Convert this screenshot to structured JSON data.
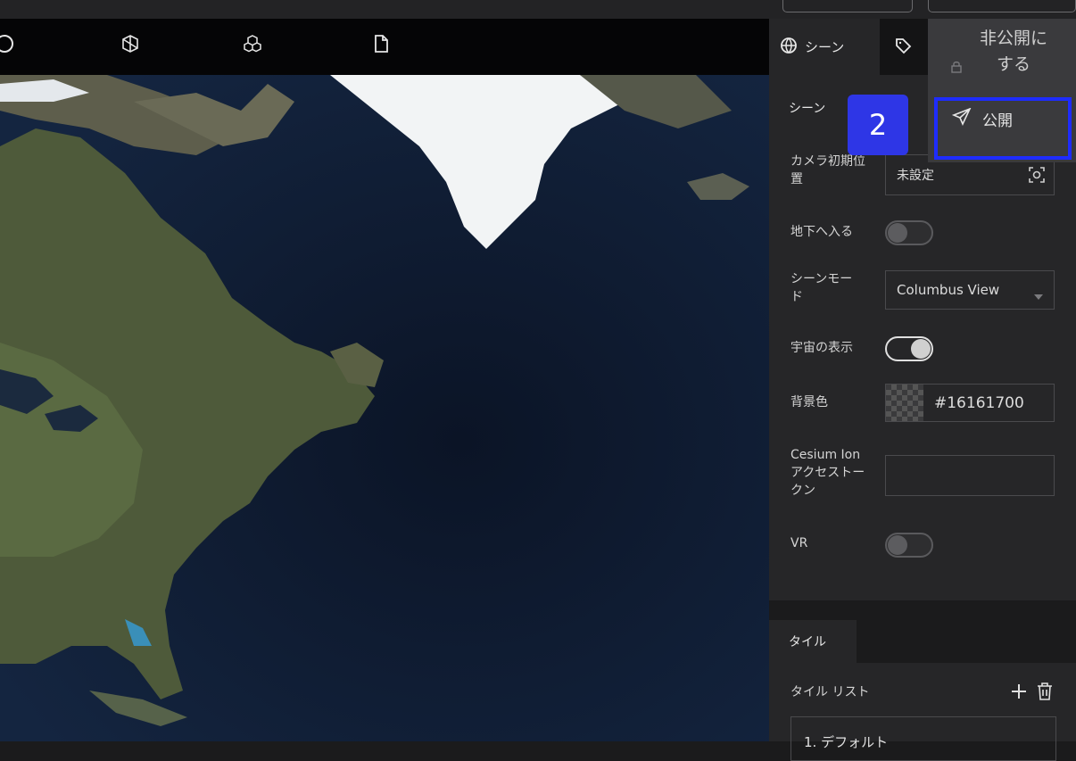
{
  "toolbar": {
    "icons": [
      "circle-icon",
      "cube-icon",
      "cubes-icon",
      "file-icon"
    ]
  },
  "panel": {
    "tabs": [
      {
        "label": "シーン",
        "icon": "globe-icon"
      },
      {
        "label": "",
        "icon": "tag-icon"
      }
    ],
    "scene": {
      "section_title": "シーン",
      "camera_label": "カメラ初期位置",
      "camera_value": "未設定",
      "underground_label": "地下へ入る",
      "underground_on": false,
      "scene_mode_label": "シーンモード",
      "scene_mode_value": "Columbus View",
      "space_label": "宇宙の表示",
      "space_on": true,
      "bg_color_label": "背景色",
      "bg_color_value": "#16161700",
      "cesium_label": "Cesium Ion アクセストークン",
      "cesium_value": "",
      "vr_label": "VR",
      "vr_on": false
    },
    "tiles": {
      "section_title": "タイル",
      "list_label": "タイル リスト",
      "first_item": "1. デフォルト"
    }
  },
  "publish_menu": {
    "unpublish_label": "非公開にする",
    "publish_label": "公開"
  },
  "annotation": {
    "badge_number": "2",
    "highlight_color": "#1e2cff"
  },
  "colors": {
    "panel_bg": "#262628",
    "toolbar_bg": "#050506",
    "accent_blue": "#2e36e6"
  }
}
